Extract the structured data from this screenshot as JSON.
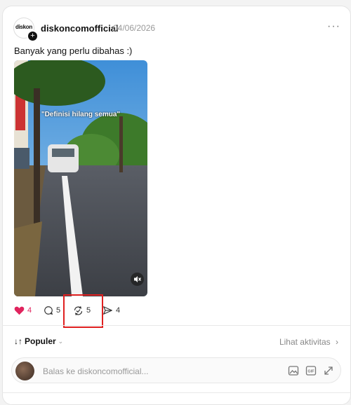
{
  "post": {
    "username": "diskoncomofficial",
    "date": "04/06/2026",
    "more_label": "···",
    "avatar_text": "diskon",
    "caption": "Banyak yang perlu dibahas :)",
    "video_overlay_text": "\"Definisi hilang semua\""
  },
  "actions": {
    "likes": "4",
    "comments": "5",
    "reposts": "5",
    "shares": "4"
  },
  "sort": {
    "label": "Populer",
    "activity_label": "Lihat aktivitas"
  },
  "reply": {
    "placeholder": "Balas ke diskoncomofficial..."
  },
  "icons": {
    "like": "heart-icon",
    "comment": "comment-icon",
    "repost": "repost-icon",
    "share": "send-icon",
    "mute": "speaker-muted-icon",
    "image": "image-icon",
    "gif": "gif-icon",
    "expand": "expand-icon"
  },
  "colors": {
    "like": "#e0245e",
    "highlight": "#e02020"
  }
}
